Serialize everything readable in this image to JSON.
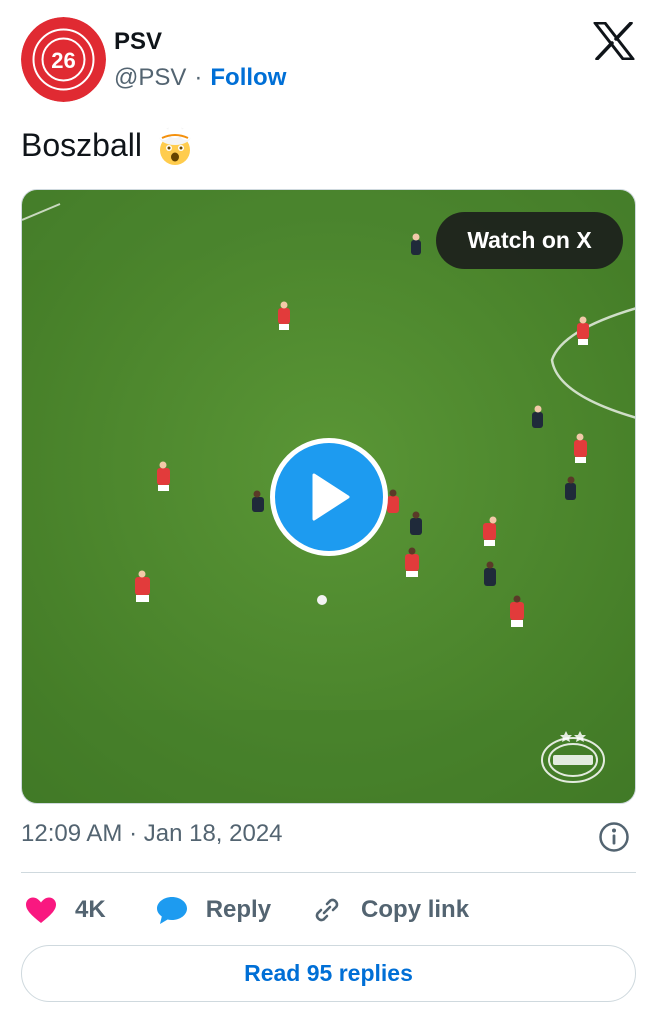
{
  "author": {
    "name": "PSV",
    "handle": "@PSV",
    "separator": "·",
    "follow_label": "Follow",
    "avatar_number": "26",
    "avatar_color": "#e02a32"
  },
  "tweet": {
    "text": "Boszball",
    "emoji": "exploding-head-emoji"
  },
  "media": {
    "watch_label": "Watch on X",
    "play_icon": "play-icon",
    "pitch_color": "#4f8a2e"
  },
  "meta": {
    "timestamp": "12:09 AM · Jan 18, 2024"
  },
  "actions": {
    "likes_count": "4K",
    "reply_label": "Reply",
    "copy_label": "Copy link"
  },
  "read_replies_label": "Read 95 replies",
  "colors": {
    "accent": "#006fd6",
    "like": "#f91880",
    "reply_icon": "#1d9bf0",
    "muted": "#536471"
  }
}
